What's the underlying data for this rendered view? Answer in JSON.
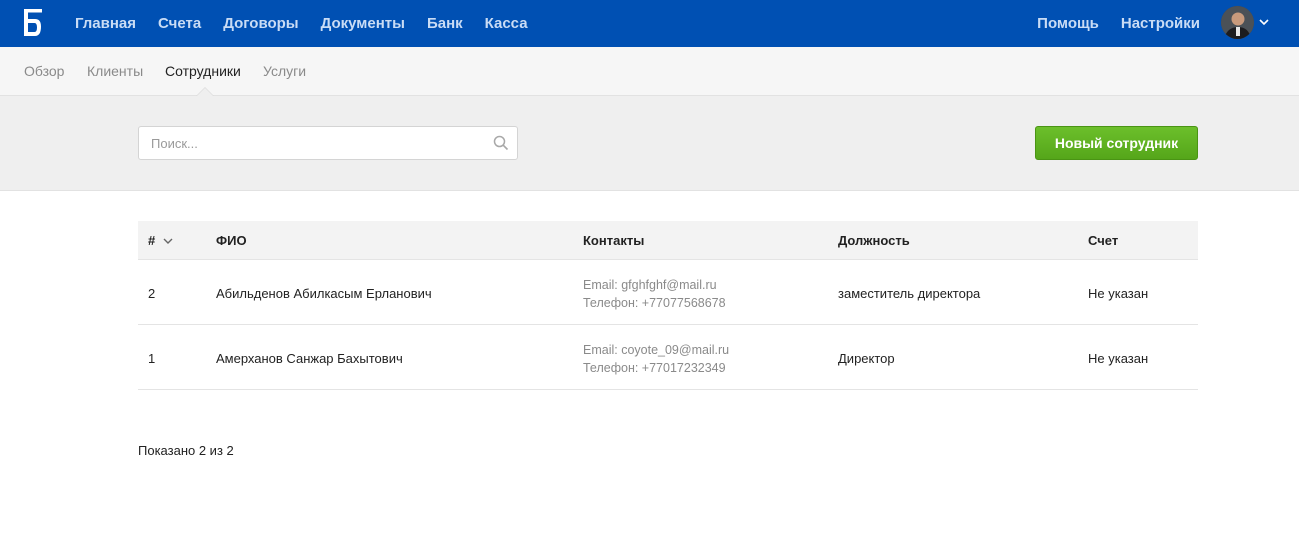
{
  "brand": {
    "logo_glyph": "Б",
    "accent": "#0050b3"
  },
  "topnav": {
    "items": [
      "Главная",
      "Счета",
      "Договоры",
      "Документы",
      "Банк",
      "Касса"
    ],
    "right": [
      "Помощь",
      "Настройки"
    ]
  },
  "subnav": {
    "items": [
      "Обзор",
      "Клиенты",
      "Сотрудники",
      "Услуги"
    ],
    "active": "Сотрудники"
  },
  "toolbar": {
    "search_placeholder": "Поиск...",
    "new_button": "Новый сотрудник",
    "new_button_color": "#5cb022"
  },
  "table": {
    "headers": [
      "#",
      "ФИО",
      "Контакты",
      "Должность",
      "Счет"
    ],
    "rows": [
      {
        "num": "2",
        "name": "Абильденов Абилкасым Ерланович",
        "email": "Email: gfghfghf@mail.ru",
        "phone": "Телефон: +77077568678",
        "position": "заместитель директора",
        "account": "Не указан"
      },
      {
        "num": "1",
        "name": "Амерханов Санжар Бахытович",
        "email": "Email: coyote_09@mail.ru",
        "phone": "Телефон: +77017232349",
        "position": "Директор",
        "account": "Не указан"
      }
    ]
  },
  "footer": {
    "shown": "Показано 2 из 2"
  }
}
